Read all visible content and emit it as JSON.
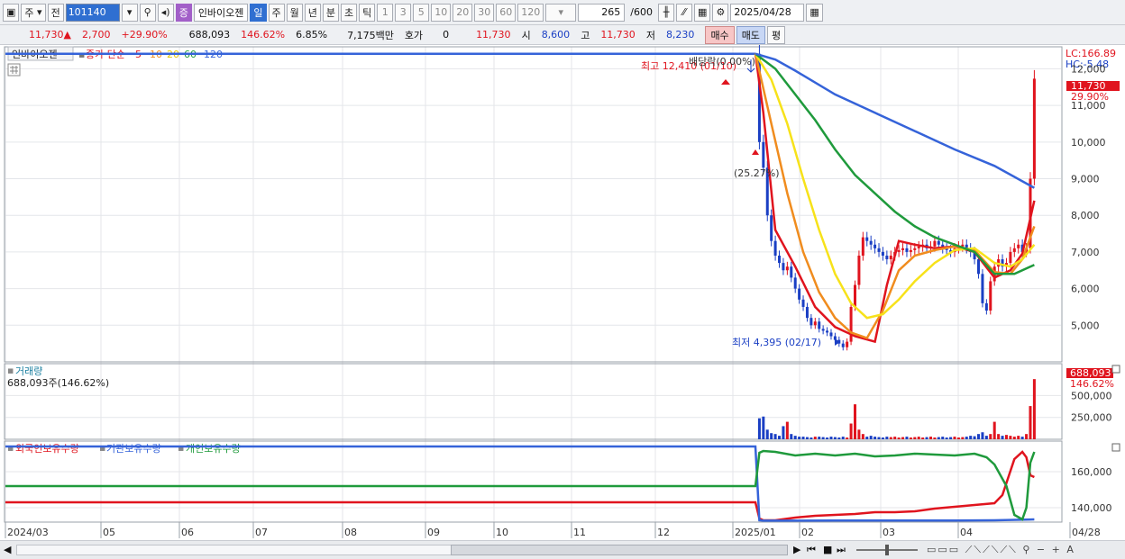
{
  "toolbar": {
    "market": "주",
    "prev": "전",
    "code": "101140",
    "name": "인바이오젠",
    "badge": "증",
    "periods": [
      "일",
      "주",
      "월",
      "년",
      "분",
      "초",
      "틱"
    ],
    "selected_period": "일",
    "intervals": [
      "1",
      "3",
      "5",
      "10",
      "20",
      "30",
      "60",
      "120"
    ],
    "count": "265",
    "count_max": "/600",
    "date": "2025/04/28",
    "icons": [
      "layout-icon",
      "dropdown-icon",
      "search-icon",
      "speaker-icon",
      "candle-icon",
      "line-icon",
      "save-icon",
      "gear-icon"
    ]
  },
  "quote": {
    "price": "11,730",
    "change": "2,700",
    "change_pct": "+29.90%",
    "volume": "688,093",
    "vol_ratio": "146.62%",
    "turnover": "6.85%",
    "amount": "7,175백만",
    "hoga_label": "호가",
    "hoga": "0",
    "hoga_price": "11,730",
    "open_label": "시",
    "open": "8,600",
    "high_label": "고",
    "high": "11,730",
    "low_label": "저",
    "low": "8,230",
    "buy": "매수",
    "sell": "매도",
    "avg": "평"
  },
  "chart_data": [
    {
      "type": "line",
      "title": "인바이오젠",
      "ma_label": "종가 단순",
      "legend": [
        "5",
        "10",
        "20",
        "60",
        "120"
      ],
      "colors": {
        "price_up": "#e0141e",
        "price_down": "#1a3fc4",
        "ma5": "#e0141e",
        "ma10": "#f08c1e",
        "ma20": "#f7e21a",
        "ma60": "#1f9a3c",
        "ma120": "#3563d9"
      },
      "y_ticks": [
        "12,000",
        "11,000",
        "10,000",
        "9,000",
        "8,000",
        "7,000",
        "6,000",
        "5,000"
      ],
      "y_tick_values": [
        12000,
        11000,
        10000,
        9000,
        8000,
        7000,
        6000,
        5000
      ],
      "ylim": [
        4000,
        12600
      ],
      "lc": "LC:166.89",
      "hc": "HC:-5.48",
      "last_price": "11,730",
      "last_pct": "29.90%",
      "annotations": {
        "high": "최고 12,410 (01/10)",
        "dividend": "배당락(0.00%)",
        "drop": "(25.27%)",
        "low": "최저 4,395 (02/17)"
      },
      "halt_price": 12410,
      "series": [
        {
          "name": "5",
          "x": [
            0,
            2,
            5,
            10,
            15,
            20,
            25,
            30,
            33,
            36,
            40,
            45,
            50,
            55,
            60,
            64,
            67,
            70
          ],
          "values": [
            12410,
            10800,
            7600,
            6600,
            5500,
            4950,
            4700,
            4550,
            6100,
            7300,
            7200,
            7100,
            7150,
            7000,
            6300,
            6500,
            6950,
            8400
          ]
        },
        {
          "name": "10",
          "x": [
            0,
            4,
            8,
            12,
            16,
            20,
            24,
            28,
            32,
            36,
            40,
            45,
            50,
            55,
            60,
            64,
            67,
            70
          ],
          "values": [
            12410,
            10500,
            8600,
            7000,
            5900,
            5200,
            4800,
            4650,
            5400,
            6500,
            6900,
            7050,
            7150,
            7050,
            6450,
            6400,
            6800,
            7700
          ]
        },
        {
          "name": "20",
          "x": [
            0,
            4,
            8,
            12,
            16,
            20,
            24,
            28,
            32,
            36,
            40,
            45,
            50,
            55,
            60,
            64,
            67,
            70
          ],
          "values": [
            12410,
            11700,
            10500,
            9000,
            7600,
            6400,
            5600,
            5200,
            5300,
            5700,
            6200,
            6700,
            7050,
            7100,
            6700,
            6600,
            6800,
            7200
          ]
        },
        {
          "name": "60",
          "x": [
            0,
            5,
            10,
            15,
            20,
            25,
            30,
            35,
            40,
            45,
            50,
            55,
            60,
            65,
            70
          ],
          "values": [
            12410,
            12000,
            11300,
            10600,
            9800,
            9100,
            8600,
            8100,
            7700,
            7400,
            7200,
            7000,
            6400,
            6400,
            6650
          ]
        },
        {
          "name": "120",
          "x": [
            0,
            5,
            10,
            20,
            30,
            40,
            50,
            60,
            70
          ],
          "values": [
            12410,
            12250,
            11950,
            11300,
            10800,
            10300,
            9800,
            9350,
            8750
          ]
        }
      ],
      "candles_x": [
        1,
        2,
        3,
        4,
        5,
        6,
        7,
        8,
        9,
        10,
        11,
        12,
        13,
        14,
        15,
        16,
        17,
        18,
        19,
        20,
        21,
        22,
        23,
        24,
        25,
        26,
        27,
        28,
        29,
        30,
        31,
        32,
        33,
        34,
        35,
        36,
        37,
        38,
        39,
        40,
        41,
        42,
        43,
        44,
        45,
        46,
        47,
        48,
        49,
        50,
        51,
        52,
        53,
        54,
        55,
        56,
        57,
        58,
        59,
        60,
        61,
        62,
        63,
        64,
        65,
        66,
        67,
        68,
        69,
        70
      ],
      "candles_close": [
        10000,
        9300,
        8000,
        7300,
        6900,
        6700,
        6500,
        6600,
        6300,
        6000,
        5700,
        5500,
        5200,
        5000,
        5100,
        4900,
        4850,
        4800,
        4700,
        4600,
        4500,
        4400,
        4550,
        5500,
        6100,
        6900,
        7400,
        7300,
        7200,
        7100,
        7000,
        6900,
        6800,
        6900,
        7000,
        7050,
        7100,
        7000,
        7050,
        7100,
        7150,
        7200,
        7100,
        7150,
        7300,
        7200,
        7100,
        7050,
        7000,
        7100,
        7150,
        7200,
        7100,
        7000,
        6800,
        6400,
        5600,
        5400,
        6200,
        6600,
        6800,
        6600,
        6700,
        7000,
        7100,
        7200,
        7000,
        7100,
        9000,
        11730
      ],
      "x_ticks": [
        "2024/03",
        "05",
        "06",
        "07",
        "08",
        "09",
        "10",
        "11",
        "12",
        "2025/01",
        "02",
        "03",
        "04",
        "04/28"
      ]
    },
    {
      "type": "bar",
      "title": "거래량",
      "subtitle": "688,093주(146.62%)",
      "y_ticks": [
        "500,000",
        "250,000"
      ],
      "y_tick_values": [
        500000,
        250000
      ],
      "ylim": [
        0,
        700000
      ],
      "last_volume": "688,093",
      "last_pct": "146.62%",
      "x": [
        1,
        2,
        3,
        4,
        5,
        6,
        7,
        8,
        9,
        10,
        11,
        12,
        13,
        14,
        15,
        16,
        17,
        18,
        19,
        20,
        21,
        22,
        23,
        24,
        25,
        26,
        27,
        28,
        29,
        30,
        31,
        32,
        33,
        34,
        35,
        36,
        37,
        38,
        39,
        40,
        41,
        42,
        43,
        44,
        45,
        46,
        47,
        48,
        49,
        50,
        51,
        52,
        53,
        54,
        55,
        56,
        57,
        58,
        59,
        60,
        61,
        62,
        63,
        64,
        65,
        66,
        67,
        68,
        69,
        70
      ],
      "values": [
        240000,
        260000,
        110000,
        70000,
        60000,
        40000,
        150000,
        200000,
        60000,
        40000,
        30000,
        30000,
        25000,
        20000,
        30000,
        30000,
        25000,
        20000,
        30000,
        25000,
        20000,
        30000,
        20000,
        180000,
        400000,
        110000,
        60000,
        30000,
        40000,
        30000,
        25000,
        20000,
        30000,
        25000,
        30000,
        20000,
        25000,
        30000,
        20000,
        25000,
        30000,
        20000,
        25000,
        30000,
        20000,
        25000,
        30000,
        20000,
        25000,
        30000,
        20000,
        25000,
        30000,
        40000,
        35000,
        60000,
        80000,
        40000,
        60000,
        200000,
        60000,
        40000,
        50000,
        40000,
        30000,
        40000,
        30000,
        60000,
        380000,
        688093
      ],
      "colors_up": "#e0141e",
      "colors_down": "#1a3fc4"
    },
    {
      "type": "line",
      "legend": [
        "외국인보유수량",
        "기관보유수량",
        "개인보유수량"
      ],
      "colors": [
        "#e0141e",
        "#3563d9",
        "#1f9a3c"
      ],
      "y_ticks": [
        "160,000",
        "140,000"
      ],
      "y_tick_values": [
        160000,
        140000
      ],
      "ylim": [
        132000,
        175000
      ],
      "series": [
        {
          "name": "외국인보유수량",
          "x": [
            -100,
            0,
            1,
            2,
            5,
            10,
            15,
            20,
            25,
            30,
            35,
            40,
            45,
            50,
            55,
            60,
            62,
            65,
            67,
            68,
            69,
            70
          ],
          "values": [
            143000,
            143000,
            134000,
            133000,
            133000,
            134500,
            135500,
            136000,
            136500,
            137500,
            137500,
            138000,
            139500,
            140500,
            141500,
            142500,
            147000,
            167000,
            171000,
            168000,
            158000,
            157000
          ]
        },
        {
          "name": "기관보유수량",
          "x": [
            -100,
            0,
            1,
            2,
            5,
            10,
            20,
            30,
            40,
            50,
            60,
            70
          ],
          "values": [
            174000,
            174000,
            133000,
            132800,
            132800,
            132800,
            132900,
            132900,
            132900,
            132900,
            133000,
            133500
          ]
        },
        {
          "name": "개인보유수량",
          "x": [
            -100,
            0,
            1,
            2,
            5,
            10,
            15,
            20,
            25,
            30,
            35,
            40,
            45,
            50,
            55,
            58,
            60,
            63,
            65,
            67,
            68,
            69,
            70
          ],
          "values": [
            152000,
            152000,
            170500,
            171500,
            171000,
            169000,
            170000,
            169000,
            170000,
            168500,
            169000,
            170000,
            169500,
            169000,
            170000,
            168000,
            164000,
            152000,
            136000,
            133500,
            140000,
            165000,
            171000
          ]
        }
      ]
    }
  ]
}
